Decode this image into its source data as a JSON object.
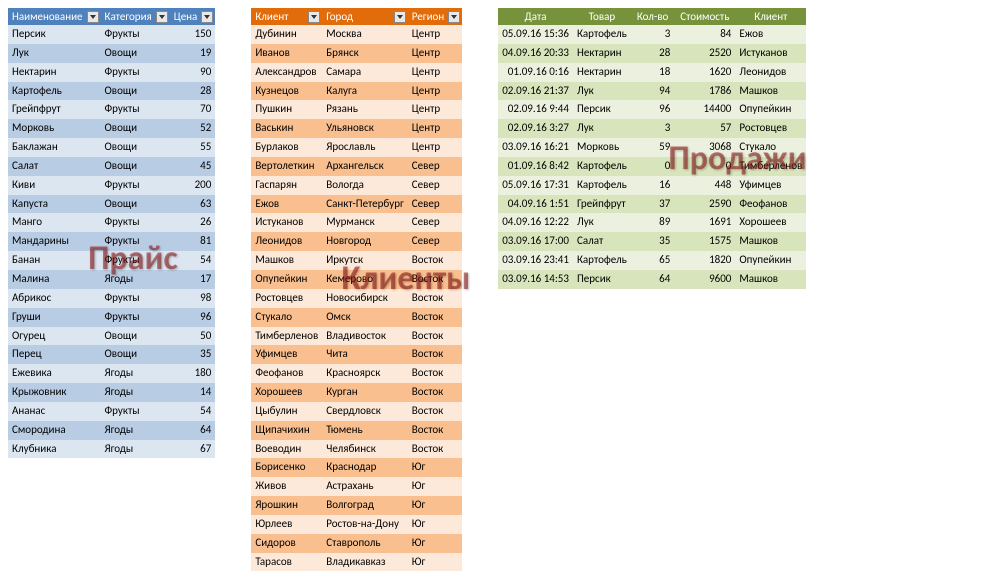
{
  "price": {
    "watermark": "Прайс",
    "headers": [
      "Наименование",
      "Категория",
      "Цена"
    ],
    "rows": [
      [
        "Персик",
        "Фрукты",
        "150"
      ],
      [
        "Лук",
        "Овощи",
        "19"
      ],
      [
        "Нектарин",
        "Фрукты",
        "90"
      ],
      [
        "Картофель",
        "Овощи",
        "28"
      ],
      [
        "Грейпфрут",
        "Фрукты",
        "70"
      ],
      [
        "Морковь",
        "Овощи",
        "52"
      ],
      [
        "Баклажан",
        "Овощи",
        "55"
      ],
      [
        "Салат",
        "Овощи",
        "45"
      ],
      [
        "Киви",
        "Фрукты",
        "200"
      ],
      [
        "Капуста",
        "Овощи",
        "63"
      ],
      [
        "Манго",
        "Фрукты",
        "26"
      ],
      [
        "Мандарины",
        "Фрукты",
        "81"
      ],
      [
        "Банан",
        "Фрукты",
        "54"
      ],
      [
        "Малина",
        "Ягоды",
        "17"
      ],
      [
        "Абрикос",
        "Фрукты",
        "98"
      ],
      [
        "Груши",
        "Фрукты",
        "96"
      ],
      [
        "Огурец",
        "Овощи",
        "50"
      ],
      [
        "Перец",
        "Овощи",
        "35"
      ],
      [
        "Ежевика",
        "Ягоды",
        "180"
      ],
      [
        "Крыжовник",
        "Ягоды",
        "14"
      ],
      [
        "Ананас",
        "Фрукты",
        "54"
      ],
      [
        "Смородина",
        "Ягоды",
        "64"
      ],
      [
        "Клубника",
        "Ягоды",
        "67"
      ]
    ]
  },
  "clients": {
    "watermark": "Клиенты",
    "headers": [
      "Клиент",
      "Город",
      "Регион"
    ],
    "rows": [
      [
        "Дубинин",
        "Москва",
        "Центр"
      ],
      [
        "Иванов",
        "Брянск",
        "Центр"
      ],
      [
        "Александров",
        "Самара",
        "Центр"
      ],
      [
        "Кузнецов",
        "Калуга",
        "Центр"
      ],
      [
        "Пушкин",
        "Рязань",
        "Центр"
      ],
      [
        "Васькин",
        "Ульяновск",
        "Центр"
      ],
      [
        "Бурлаков",
        "Ярославль",
        "Центр"
      ],
      [
        "Вертолеткин",
        "Архангельск",
        "Север"
      ],
      [
        "Гаспарян",
        "Вологда",
        "Север"
      ],
      [
        "Ежов",
        "Санкт-Петербург",
        "Север"
      ],
      [
        "Истуканов",
        "Мурманск",
        "Север"
      ],
      [
        "Леонидов",
        "Новгород",
        "Север"
      ],
      [
        "Машков",
        "Иркутск",
        "Восток"
      ],
      [
        "Опупейкин",
        "Кемерово",
        "Восток"
      ],
      [
        "Ростовцев",
        "Новосибирск",
        "Восток"
      ],
      [
        "Стукало",
        "Омск",
        "Восток"
      ],
      [
        "Тимберленов",
        "Владивосток",
        "Восток"
      ],
      [
        "Уфимцев",
        "Чита",
        "Восток"
      ],
      [
        "Феофанов",
        "Красноярск",
        "Восток"
      ],
      [
        "Хорошеев",
        "Курган",
        "Восток"
      ],
      [
        "Цыбулин",
        "Свердловск",
        "Восток"
      ],
      [
        "Щипачихин",
        "Тюмень",
        "Восток"
      ],
      [
        "Воеводин",
        "Челябинск",
        "Восток"
      ],
      [
        "Борисенко",
        "Краснодар",
        "Юг"
      ],
      [
        "Живов",
        "Астрахань",
        "Юг"
      ],
      [
        "Ярошкин",
        "Волгоград",
        "Юг"
      ],
      [
        "Юрлеев",
        "Ростов-на-Дону",
        "Юг"
      ],
      [
        "Сидоров",
        "Ставрополь",
        "Юг"
      ],
      [
        "Тарасов",
        "Владикавказ",
        "Юг"
      ]
    ]
  },
  "sales": {
    "watermark": "Продажи",
    "headers": [
      "Дата",
      "Товар",
      "Кол-во",
      "Стоимость",
      "Клиент"
    ],
    "rows": [
      [
        "05.09.16 15:36",
        "Картофель",
        "3",
        "84",
        "Ежов"
      ],
      [
        "04.09.16 20:33",
        "Нектарин",
        "28",
        "2520",
        "Истуканов"
      ],
      [
        "01.09.16 0:16",
        "Нектарин",
        "18",
        "1620",
        "Леонидов"
      ],
      [
        "02.09.16 21:37",
        "Лук",
        "94",
        "1786",
        "Машков"
      ],
      [
        "02.09.16 9:44",
        "Персик",
        "96",
        "14400",
        "Опупейкин"
      ],
      [
        "02.09.16 3:27",
        "Лук",
        "3",
        "57",
        "Ростовцев"
      ],
      [
        "03.09.16 16:21",
        "Морковь",
        "59",
        "3068",
        "Стукало"
      ],
      [
        "01.09.16 8:42",
        "Картофель",
        "0",
        "0",
        "Тимберленов"
      ],
      [
        "05.09.16 17:31",
        "Картофель",
        "16",
        "448",
        "Уфимцев"
      ],
      [
        "04.09.16 1:51",
        "Грейпфрут",
        "37",
        "2590",
        "Феофанов"
      ],
      [
        "04.09.16 12:22",
        "Лук",
        "89",
        "1691",
        "Хорошеев"
      ],
      [
        "03.09.16 17:00",
        "Салат",
        "35",
        "1575",
        "Машков"
      ],
      [
        "03.09.16 23:41",
        "Картофель",
        "65",
        "1820",
        "Опупейкин"
      ],
      [
        "03.09.16 14:53",
        "Персик",
        "64",
        "9600",
        "Машков"
      ]
    ]
  }
}
